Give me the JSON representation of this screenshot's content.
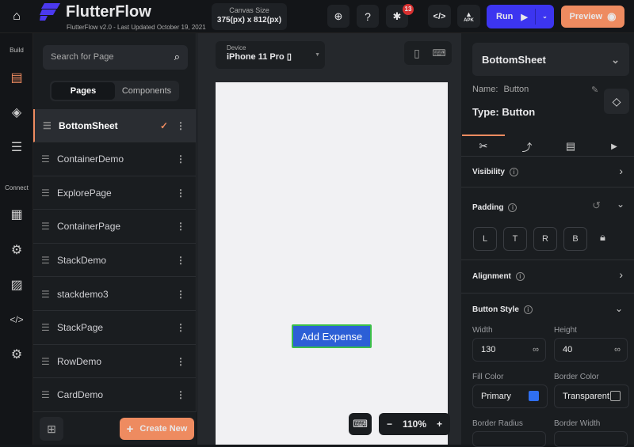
{
  "header": {
    "app_name": "FlutterFlow",
    "subtitle": "FlutterFlow v2.0 - Last Updated October 19, 2021",
    "canvas_size_label": "Canvas Size",
    "canvas_size_value": "375(px) x 812(px)",
    "bug_count": "13",
    "apk_label": "APK",
    "run_label": "Run",
    "preview_label": "Preview"
  },
  "rail": {
    "build_label": "Build",
    "connect_label": "Connect"
  },
  "pages_panel": {
    "search_placeholder": "Search for Page",
    "tabs": [
      "Pages",
      "Components"
    ],
    "pages": [
      "BottomSheet",
      "ContainerDemo",
      "ExplorePage",
      "ContainerPage",
      "StackDemo",
      "stackdemo3",
      "StackPage",
      "RowDemo",
      "CardDemo"
    ],
    "create_new_label": "Create New"
  },
  "canvas": {
    "device_label": "Device",
    "device_value": "iPhone 11 Pro",
    "button_text": "Add Expense",
    "zoom": "110%"
  },
  "props": {
    "page_name": "BottomSheet",
    "name_label": "Name:",
    "name_value": "Button",
    "type_label": "Type:",
    "type_value": "Button",
    "visibility": "Visibility",
    "padding": "Padding",
    "padding_boxes": [
      "L",
      "T",
      "R",
      "B"
    ],
    "alignment": "Alignment",
    "button_style": "Button Style",
    "width_label": "Width",
    "width_value": "130",
    "height_label": "Height",
    "height_value": "40",
    "fill_color_label": "Fill Color",
    "fill_color_value": "Primary",
    "border_color_label": "Border Color",
    "border_color_value": "Transparent",
    "border_radius_label": "Border Radius",
    "border_width_label": "Border Width",
    "fill_color_hex": "#2f6ff0"
  },
  "colors": {
    "accent": "#ee8b60",
    "run": "#3c35f0",
    "primary_button": "#2c5fd6"
  }
}
